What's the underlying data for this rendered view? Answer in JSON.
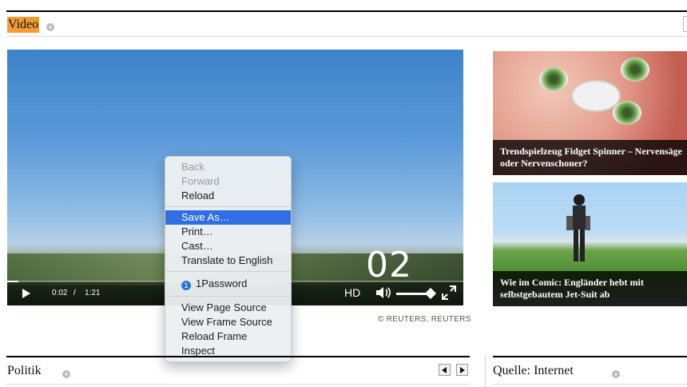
{
  "section": {
    "title": "Video"
  },
  "player": {
    "counter": "02",
    "time_current": "0:02",
    "time_separator": "/",
    "time_duration": "1:21",
    "hd_label": "HD",
    "progress": 0.025,
    "volume": 0.9,
    "credit": "© REUTERS, REUTERS"
  },
  "context_menu": {
    "items": [
      {
        "label": "Back",
        "enabled": false
      },
      {
        "label": "Forward",
        "enabled": false
      },
      {
        "label": "Reload",
        "enabled": true
      },
      {
        "label": "Save As…",
        "enabled": true,
        "selected": true
      },
      {
        "label": "Print…",
        "enabled": true
      },
      {
        "label": "Cast…",
        "enabled": true
      },
      {
        "label": "Translate to English",
        "enabled": true
      },
      {
        "label": "1Password",
        "enabled": true,
        "icon": "1password-icon"
      },
      {
        "label": "View Page Source",
        "enabled": true
      },
      {
        "label": "View Frame Source",
        "enabled": true
      },
      {
        "label": "Reload Frame",
        "enabled": true
      },
      {
        "label": "Inspect",
        "enabled": true
      }
    ]
  },
  "cards": [
    {
      "title": "Trendspielzeug Fidget Spinner – Nervensäge oder Nervenschoner?"
    },
    {
      "title": "Wie im Comic: Engländer hebt mit selbstgebautem Jet-Suit ab"
    }
  ],
  "bottom": {
    "left_title": "Politik",
    "right_title": "Quelle: Internet"
  },
  "colors": {
    "section_highlight": "#f39c34",
    "menu_selection": "#2f6fe3"
  }
}
